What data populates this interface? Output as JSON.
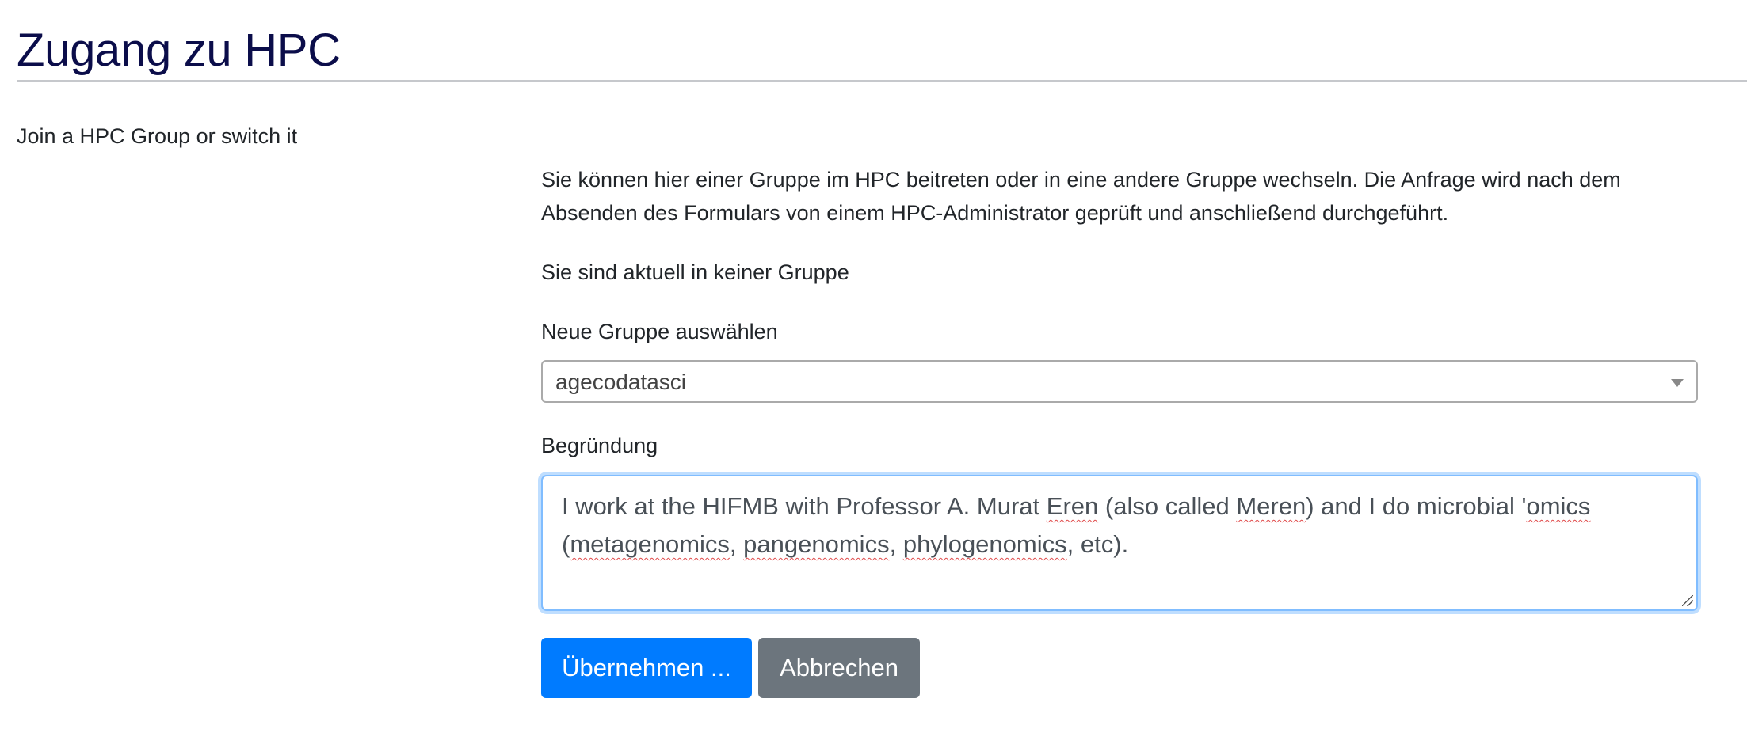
{
  "page": {
    "title": "Zugang zu HPC",
    "section_label": "Join a HPC Group or switch it"
  },
  "form": {
    "intro_line1": "Sie können hier einer Gruppe im HPC beitreten oder in eine andere Gruppe wechseln. Die Anfrage wird nach dem",
    "intro_line2": "Absenden des Formulars von einem HPC-Administrator geprüft und anschließend durchgeführt.",
    "current_group_text": "Sie sind aktuell in keiner Gruppe",
    "group_label": "Neue Gruppe auswählen",
    "group_selected": "agecodatasci",
    "reason_label": "Begründung",
    "reason_value": "I work at the HIFMB with Professor A. Murat Eren (also called Meren) and I do microbial 'omics (metagenomics, pangenomics, phylogenomics, etc).",
    "submit_label": "Übernehmen ...",
    "cancel_label": "Abbrechen"
  },
  "colors": {
    "title": "#0b0d4a",
    "primary": "#007bff",
    "secondary": "#6c757d",
    "focus_border": "#80bdff"
  },
  "icons": {
    "select_caret": "chevron-down-icon",
    "resize_grip": "resize-grip-icon"
  }
}
